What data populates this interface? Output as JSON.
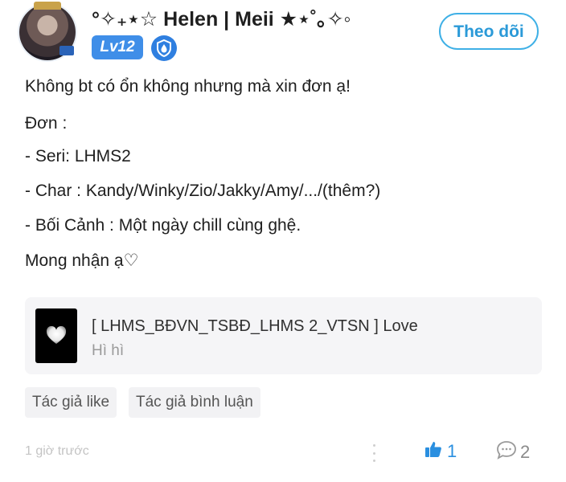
{
  "header": {
    "username": "°✧₊⋆☆ Helen | Meii ★⋆˚｡✧◦",
    "level": "Lv12",
    "follow_label": "Theo dõi"
  },
  "post": {
    "lines": [
      "Không bt có ổn không nhưng mà xin đơn ạ!",
      "Đơn :",
      "- Seri: LHMS2",
      "- Char : Kandy/Winky/Zio/Jakky/Amy/.../(thêm?)",
      "- Bối Cảnh : Một ngày chill cùng ghệ.",
      "Mong nhận ạ♡"
    ]
  },
  "link_card": {
    "title": "[ LHMS_BĐVN_TSBĐ_LHMS 2_VTSN ] Love",
    "subtitle": "Hì hì"
  },
  "tags": [
    "Tác giả like",
    "Tác giả bình luận"
  ],
  "footer": {
    "time": "1 giờ trước",
    "likes": "1",
    "comments": "2"
  },
  "colors": {
    "accent": "#2b9ad8",
    "level_badge": "#3f8ee8",
    "like": "#2a8fe0"
  },
  "icons": {
    "level": "shield-drop-icon",
    "card_thumbnail": "heart-icon",
    "more": "more-vertical-icon",
    "like": "thumbs-up-icon",
    "comment": "comment-bubble-icon"
  }
}
